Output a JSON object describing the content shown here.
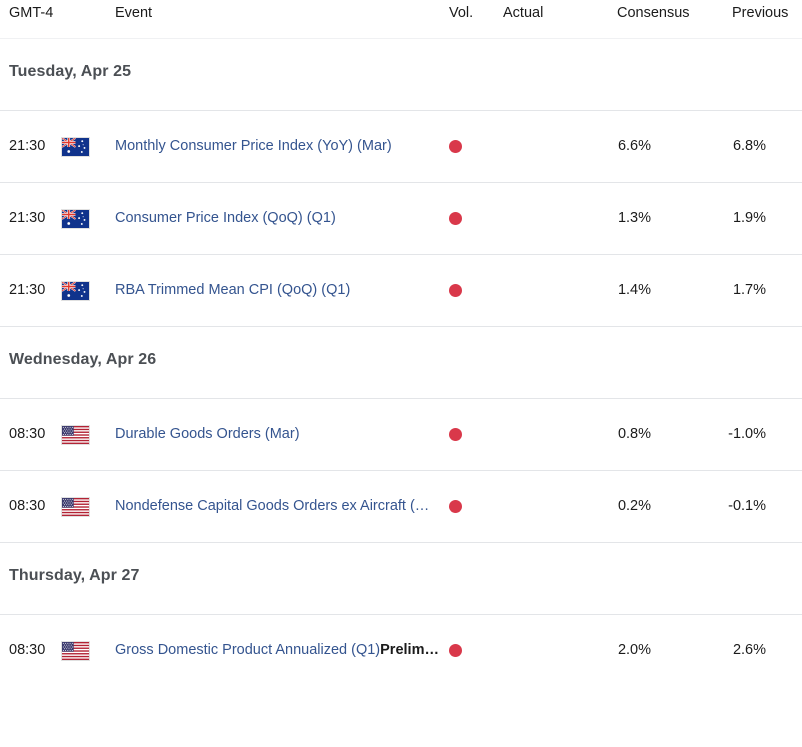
{
  "header": {
    "timezone_label": "GMT-4",
    "event_label": "Event",
    "vol_label": "Vol.",
    "actual_label": "Actual",
    "consensus_label": "Consensus",
    "previous_label": "Previous"
  },
  "colors": {
    "link": "#34548f",
    "volatility_high": "#d9384a",
    "day_heading": "#4b4f54",
    "divider": "#e3e5e8"
  },
  "days": [
    {
      "date_label": "Tuesday, Apr 25",
      "events": [
        {
          "time": "21:30",
          "flag": "australia-flag",
          "name": "Monthly Consumer Price Index (YoY) (Mar)",
          "name_bold": "",
          "volatility": "high",
          "actual": "",
          "consensus": "6.6%",
          "previous": "6.8%"
        },
        {
          "time": "21:30",
          "flag": "australia-flag",
          "name": "Consumer Price Index (QoQ) (Q1)",
          "name_bold": "",
          "volatility": "high",
          "actual": "",
          "consensus": "1.3%",
          "previous": "1.9%"
        },
        {
          "time": "21:30",
          "flag": "australia-flag",
          "name": "RBA Trimmed Mean CPI (QoQ) (Q1)",
          "name_bold": "",
          "volatility": "high",
          "actual": "",
          "consensus": "1.4%",
          "previous": "1.7%"
        }
      ]
    },
    {
      "date_label": "Wednesday, Apr 26",
      "events": [
        {
          "time": "08:30",
          "flag": "usa-flag",
          "name": "Durable Goods Orders (Mar)",
          "name_bold": "",
          "volatility": "high",
          "actual": "",
          "consensus": "0.8%",
          "previous": "-1.0%"
        },
        {
          "time": "08:30",
          "flag": "usa-flag",
          "name": "Nondefense Capital Goods Orders ex Aircraft (…",
          "name_bold": "",
          "volatility": "high",
          "actual": "",
          "consensus": "0.2%",
          "previous": "-0.1%"
        }
      ]
    },
    {
      "date_label": "Thursday, Apr 27",
      "events": [
        {
          "time": "08:30",
          "flag": "usa-flag",
          "name": "Gross Domestic Product Annualized (Q1)",
          "name_bold": "Prelim…",
          "volatility": "high",
          "actual": "",
          "consensus": "2.0%",
          "previous": "2.6%"
        }
      ]
    }
  ]
}
